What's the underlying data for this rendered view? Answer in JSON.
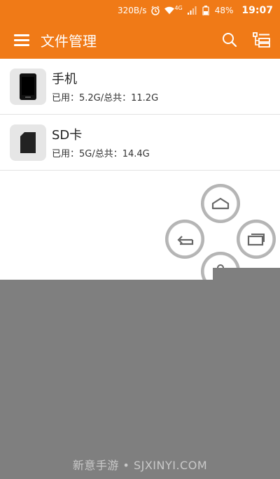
{
  "status_bar": {
    "speed": "320B/s",
    "network": "4G",
    "battery": "48%",
    "time": "19:07",
    "icons": [
      "alarm-icon",
      "wifi-icon",
      "signal-icon",
      "battery-icon"
    ]
  },
  "app_bar": {
    "title": "文件管理",
    "icons": [
      "menu-icon",
      "search-icon",
      "list-view-icon"
    ]
  },
  "storage": [
    {
      "name": "手机",
      "usage": "已用：5.2G/总共：11.2G",
      "icon": "phone-icon"
    },
    {
      "name": "SD卡",
      "usage": "已用：5G/总共：14.4G",
      "icon": "sd-card-icon"
    }
  ],
  "assistive_touch": [
    "home-icon",
    "back-icon",
    "recent-apps-icon",
    "lock-icon"
  ],
  "watermark": "新意手游 • SJXINYI.COM",
  "colors": {
    "accent": "#f07a17",
    "overlay": "#7f7f7f"
  }
}
